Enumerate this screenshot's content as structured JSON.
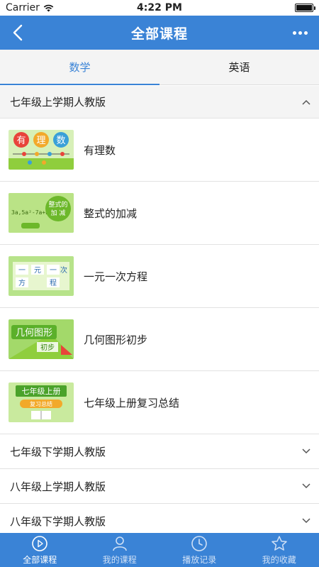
{
  "status_bar": {
    "carrier": "Carrier",
    "time": "4:22 PM"
  },
  "nav": {
    "title": "全部课程"
  },
  "tabs": [
    {
      "label": "数学",
      "active": true
    },
    {
      "label": "英语",
      "active": false
    }
  ],
  "sections": [
    {
      "title": "七年级上学期人教版",
      "expanded": true,
      "items": [
        {
          "title": "有理数",
          "thumb_icon": "rational-numbers-thumbnail",
          "thumb_text": "有理数"
        },
        {
          "title": "整式的加减",
          "thumb_icon": "polynomial-thumbnail",
          "thumb_text": "整式的加减"
        },
        {
          "title": "一元一次方程",
          "thumb_icon": "linear-equation-thumbnail",
          "thumb_text": "一元一次方程"
        },
        {
          "title": "几何图形初步",
          "thumb_icon": "geometry-thumbnail",
          "thumb_text": "几何图形初步"
        },
        {
          "title": "七年级上册复习总结",
          "thumb_icon": "review-thumbnail",
          "thumb_text": "七年级上册 复习总结"
        }
      ]
    },
    {
      "title": "七年级下学期人教版",
      "expanded": false
    },
    {
      "title": "八年级上学期人教版",
      "expanded": false
    },
    {
      "title": "八年级下学期人教版",
      "expanded": false
    }
  ],
  "tab_bar": [
    {
      "label": "全部课程",
      "icon": "play-circle-icon",
      "active": true
    },
    {
      "label": "我的课程",
      "icon": "person-icon",
      "active": false
    },
    {
      "label": "播放记录",
      "icon": "clock-icon",
      "active": false
    },
    {
      "label": "我的收藏",
      "icon": "star-icon",
      "active": false
    }
  ],
  "colors": {
    "accent": "#3a83d6",
    "thumb_green": "#8fce3d"
  }
}
